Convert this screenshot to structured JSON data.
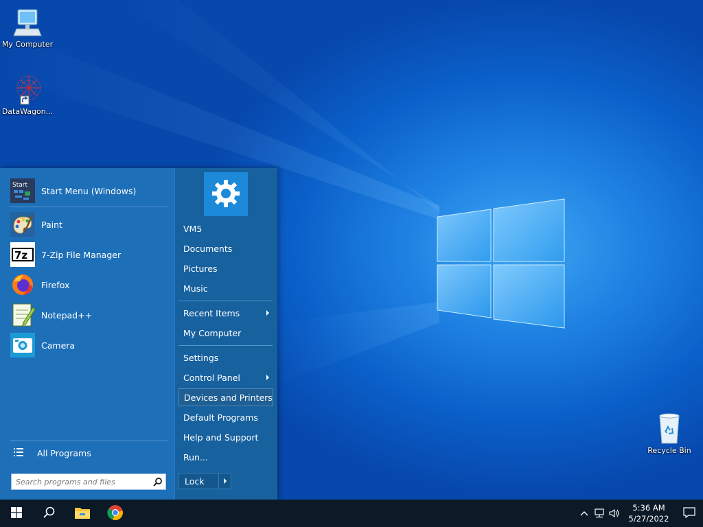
{
  "desktop": {
    "icons": [
      {
        "label": "My Computer",
        "icon": "monitor-icon"
      },
      {
        "label": "DataWagon...",
        "icon": "datawagon-logo-icon"
      },
      {
        "label": "Recycle Bin",
        "icon": "recycle-bin-icon"
      }
    ]
  },
  "start_menu": {
    "pinned": {
      "label": "Start Menu (Windows)",
      "icon": "start-menu-app-icon",
      "icon_text": "Start"
    },
    "apps": [
      {
        "label": "Paint",
        "icon": "paint-palette-icon"
      },
      {
        "label": "7-Zip File Manager",
        "icon": "7zip-icon",
        "icon_text": "7z"
      },
      {
        "label": "Firefox",
        "icon": "firefox-icon"
      },
      {
        "label": "Notepad++",
        "icon": "notepadpp-icon"
      },
      {
        "label": "Camera",
        "icon": "camera-icon"
      }
    ],
    "all_programs": "All Programs",
    "search_placeholder": "Search programs and files",
    "right": {
      "tile_icon": "gear-icon",
      "links": [
        {
          "label": "VM5"
        },
        {
          "label": "Documents"
        },
        {
          "label": "Pictures"
        },
        {
          "label": "Music"
        },
        {
          "label": "Recent Items",
          "submenu": true
        },
        {
          "label": "My Computer"
        },
        {
          "label": "Settings"
        },
        {
          "label": "Control Panel",
          "submenu": true
        },
        {
          "label": "Devices and Printers",
          "highlighted": true
        },
        {
          "label": "Default Programs"
        },
        {
          "label": "Help and Support"
        },
        {
          "label": "Run..."
        }
      ],
      "lock_label": "Lock"
    }
  },
  "taskbar": {
    "buttons": [
      "windows-start-icon",
      "search-icon",
      "file-explorer-icon",
      "chrome-icon"
    ],
    "tray": {
      "icons": [
        "chevron-up-icon",
        "network-icon",
        "volume-icon"
      ],
      "time": "5:36 AM",
      "date": "5/27/2022",
      "notification_icon": "notification-icon"
    }
  },
  "colors": {
    "menu_bg": "#1d6fb8",
    "menu_right_bg": "#17619f",
    "taskbar_bg": "#0c1a27",
    "highlight": "#1f5f94"
  }
}
